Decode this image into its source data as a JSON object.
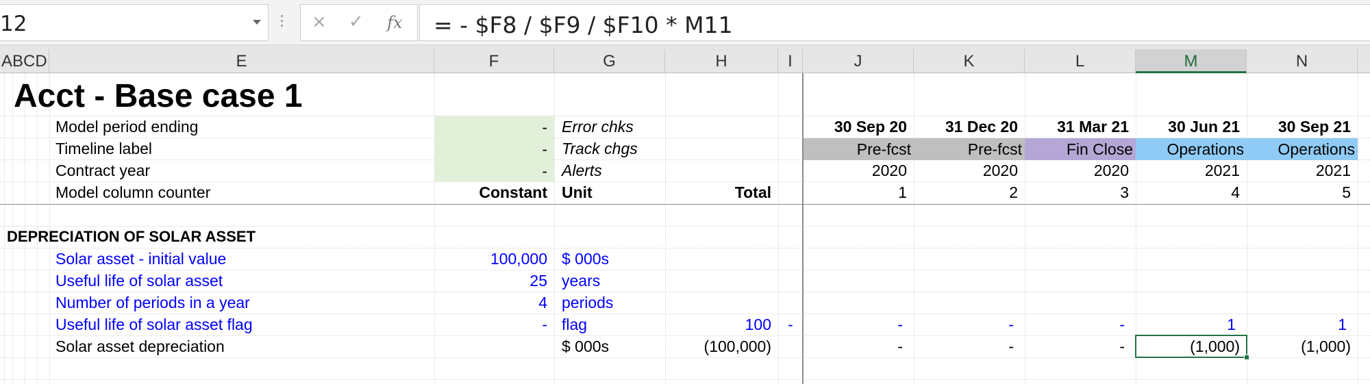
{
  "formula_bar": {
    "name_box": "12",
    "cancel_icon": "×",
    "enter_icon": "✓",
    "fx_icon": "fx",
    "formula": "= - $F8 / $F9 / $F10 * M11"
  },
  "columns": [
    "ABCD",
    "E",
    "F",
    "G",
    "H",
    "I",
    "J",
    "K",
    "L",
    "M",
    "N"
  ],
  "selected_column": "M",
  "title": "Acct - Base case 1",
  "header_rows": {
    "period_ending": {
      "label": "Model period ending",
      "f": "-",
      "g": "Error chks",
      "j": "30 Sep 20",
      "k": "31 Dec 20",
      "l": "31 Mar 21",
      "m": "30 Jun 21",
      "n": "30 Sep 21"
    },
    "timeline": {
      "label": "Timeline label",
      "f": "-",
      "g": "Track chgs",
      "j": "Pre-fcst",
      "k": "Pre-fcst",
      "l": "Fin Close",
      "m": "Operations",
      "n": "Operations"
    },
    "contract_year": {
      "label": "Contract year",
      "f": "-",
      "g": "Alerts",
      "j": "2020",
      "k": "2020",
      "l": "2020",
      "m": "2021",
      "n": "2021"
    },
    "counter": {
      "label": "Model column counter",
      "f": "Constant",
      "g": "Unit",
      "h": "Total",
      "j": "1",
      "k": "2",
      "l": "3",
      "m": "4",
      "n": "5"
    }
  },
  "section_title": "DEPRECIATION OF SOLAR ASSET",
  "rows": [
    {
      "label": "Solar asset - initial value",
      "f": "100,000",
      "g": "$ 000s",
      "h": "",
      "i": "",
      "j": "",
      "k": "",
      "l": "",
      "m": "",
      "n": ""
    },
    {
      "label": "Useful life of solar asset",
      "f": "25",
      "g": "years",
      "h": "",
      "i": "",
      "j": "",
      "k": "",
      "l": "",
      "m": "",
      "n": ""
    },
    {
      "label": "Number of periods in a year",
      "f": "4",
      "g": "periods",
      "h": "",
      "i": "",
      "j": "",
      "k": "",
      "l": "",
      "m": "",
      "n": ""
    },
    {
      "label": "Useful life of solar asset flag",
      "f": "-",
      "g": "flag",
      "h": "100",
      "i": "-",
      "j": "-",
      "k": "-",
      "l": "-",
      "m": "1",
      "n": "1"
    },
    {
      "label": "Solar asset depreciation",
      "f": "",
      "g": "$ 000s",
      "h": "(100,000)",
      "i": "",
      "j": "-",
      "k": "-",
      "l": "-",
      "m": "(1,000)",
      "n": "(1,000)"
    }
  ],
  "colors": {
    "input_blue": "#0000ff",
    "constant_bg": "#e2f0d9",
    "prefcst_bg": "#bfbfbf",
    "finclose_bg": "#b4a7d6",
    "operations_bg": "#8fcbf5",
    "selection_green": "#217346"
  }
}
